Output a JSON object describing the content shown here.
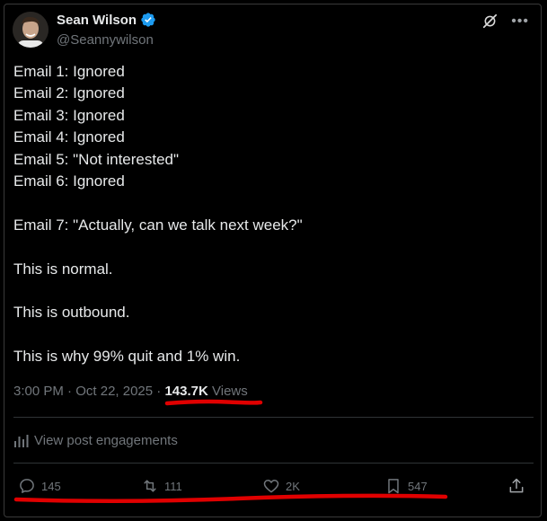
{
  "author": {
    "name": "Sean Wilson",
    "handle": "@Seannywilson",
    "verified": true,
    "avatar_icon": "profile-photo-avatar"
  },
  "header_icons": {
    "grok": "grok-icon",
    "more": "more-icon"
  },
  "tweet": {
    "lines": [
      "Email 1: Ignored",
      "Email 2: Ignored",
      "Email 3: Ignored",
      "Email 4: Ignored",
      "Email 5: \"Not interested\"",
      "Email 6: Ignored",
      "",
      "Email 7: \"Actually, can we talk next week?\"",
      "",
      "This is normal.",
      "",
      "This is outbound.",
      "",
      "This is why 99% quit and 1% win."
    ]
  },
  "meta": {
    "time": "3:00 PM",
    "separator": " · ",
    "date": "Oct 22, 2025",
    "separator2": " · ",
    "views_count": "143.7K",
    "views_label": " Views"
  },
  "engagements": {
    "label": "View post engagements",
    "icon": "bar-chart-icon"
  },
  "actions": {
    "replies": "145",
    "reposts": "111",
    "likes": "2K",
    "bookmarks": "547"
  },
  "colors": {
    "background": "#000000",
    "text": "#e7e9ea",
    "muted": "#71767b",
    "verified": "#1d9bf0",
    "annotation_red": "#e00000"
  }
}
